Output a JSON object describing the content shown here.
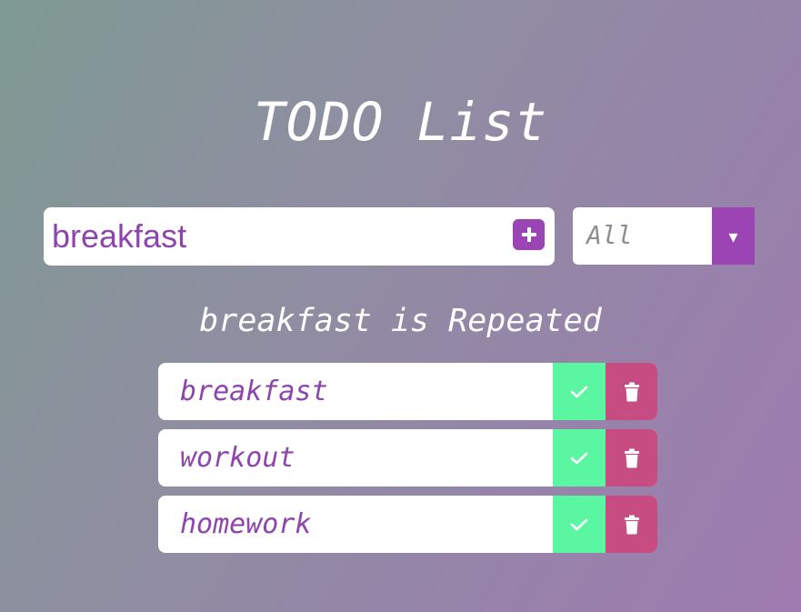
{
  "header": {
    "title": "TODO List"
  },
  "form": {
    "input_value": "breakfast",
    "add_icon": "plus-icon",
    "filter_selected": "All",
    "filter_arrow": "▾"
  },
  "message": "breakfast is Repeated",
  "todos": [
    {
      "text": "breakfast"
    },
    {
      "text": "workout"
    },
    {
      "text": "homework"
    }
  ],
  "colors": {
    "accent": "#9b45b5",
    "complete": "#5af6a2",
    "delete": "#c74c82",
    "todo_text": "#8e44ad"
  },
  "icons": {
    "complete": "check-icon",
    "delete": "trash-icon"
  }
}
